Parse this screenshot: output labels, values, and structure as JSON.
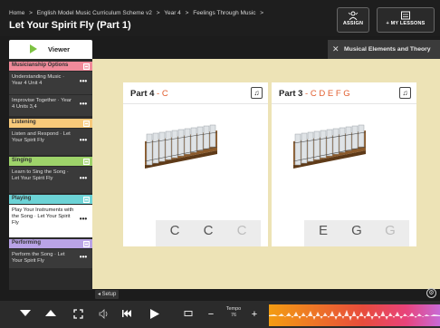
{
  "header": {
    "breadcrumb": [
      "Home",
      ">",
      "English Model Music Curriculum Scheme v2",
      ">",
      "Year 4",
      ">",
      "Feelings Through Music",
      ">"
    ],
    "title": "Let Your Spirit Fly (Part 1)",
    "assign_label": "ASSIGN",
    "my_lessons_label": "+ MY LESSONS"
  },
  "tabs": {
    "viewer_label": "Viewer",
    "theory_label": "Musical Elements and Theory"
  },
  "sidebar": {
    "sections": [
      {
        "title": "Musicianship Options",
        "color": "#f08a9a"
      },
      {
        "title": "Listening",
        "color": "#f7c97a"
      },
      {
        "title": "Singing",
        "color": "#9ed36a"
      },
      {
        "title": "Playing",
        "color": "#6cd3d6"
      },
      {
        "title": "Performing",
        "color": "#b9a3e6"
      }
    ],
    "items": [
      {
        "label": "Understanding Music · Year 4 Unit 4"
      },
      {
        "label": "Improvise Together · Year 4 Units 3,4"
      },
      {
        "label": "Listen and Respond · Let Your Spirit Fly"
      },
      {
        "label": "Learn to Sing the Song · Let Your Spirit Fly"
      },
      {
        "label": "Play Your Instruments with the Song · Let Your Spirit Fly"
      },
      {
        "label": "Perform the Song · Let Your Spirit Fly"
      }
    ],
    "more_glyph": "•••"
  },
  "cards": [
    {
      "part": "Part 4",
      "notes": "- C",
      "cells": [
        "C",
        "C",
        "C"
      ]
    },
    {
      "part": "Part 3",
      "notes": "- C D E F G",
      "cells": [
        "E",
        "G",
        "G"
      ]
    }
  ],
  "note_icon": "♫",
  "setup_label": "◂ Setup",
  "settings_icon": "⚙",
  "toolbar": {
    "tempo_label": "Tempo",
    "tempo_value": "76",
    "minus": "−",
    "plus": "+"
  },
  "colors": {
    "accent_orange": "#e15d2e",
    "play_green": "#7dc242",
    "workspace": "#ede3b6"
  }
}
